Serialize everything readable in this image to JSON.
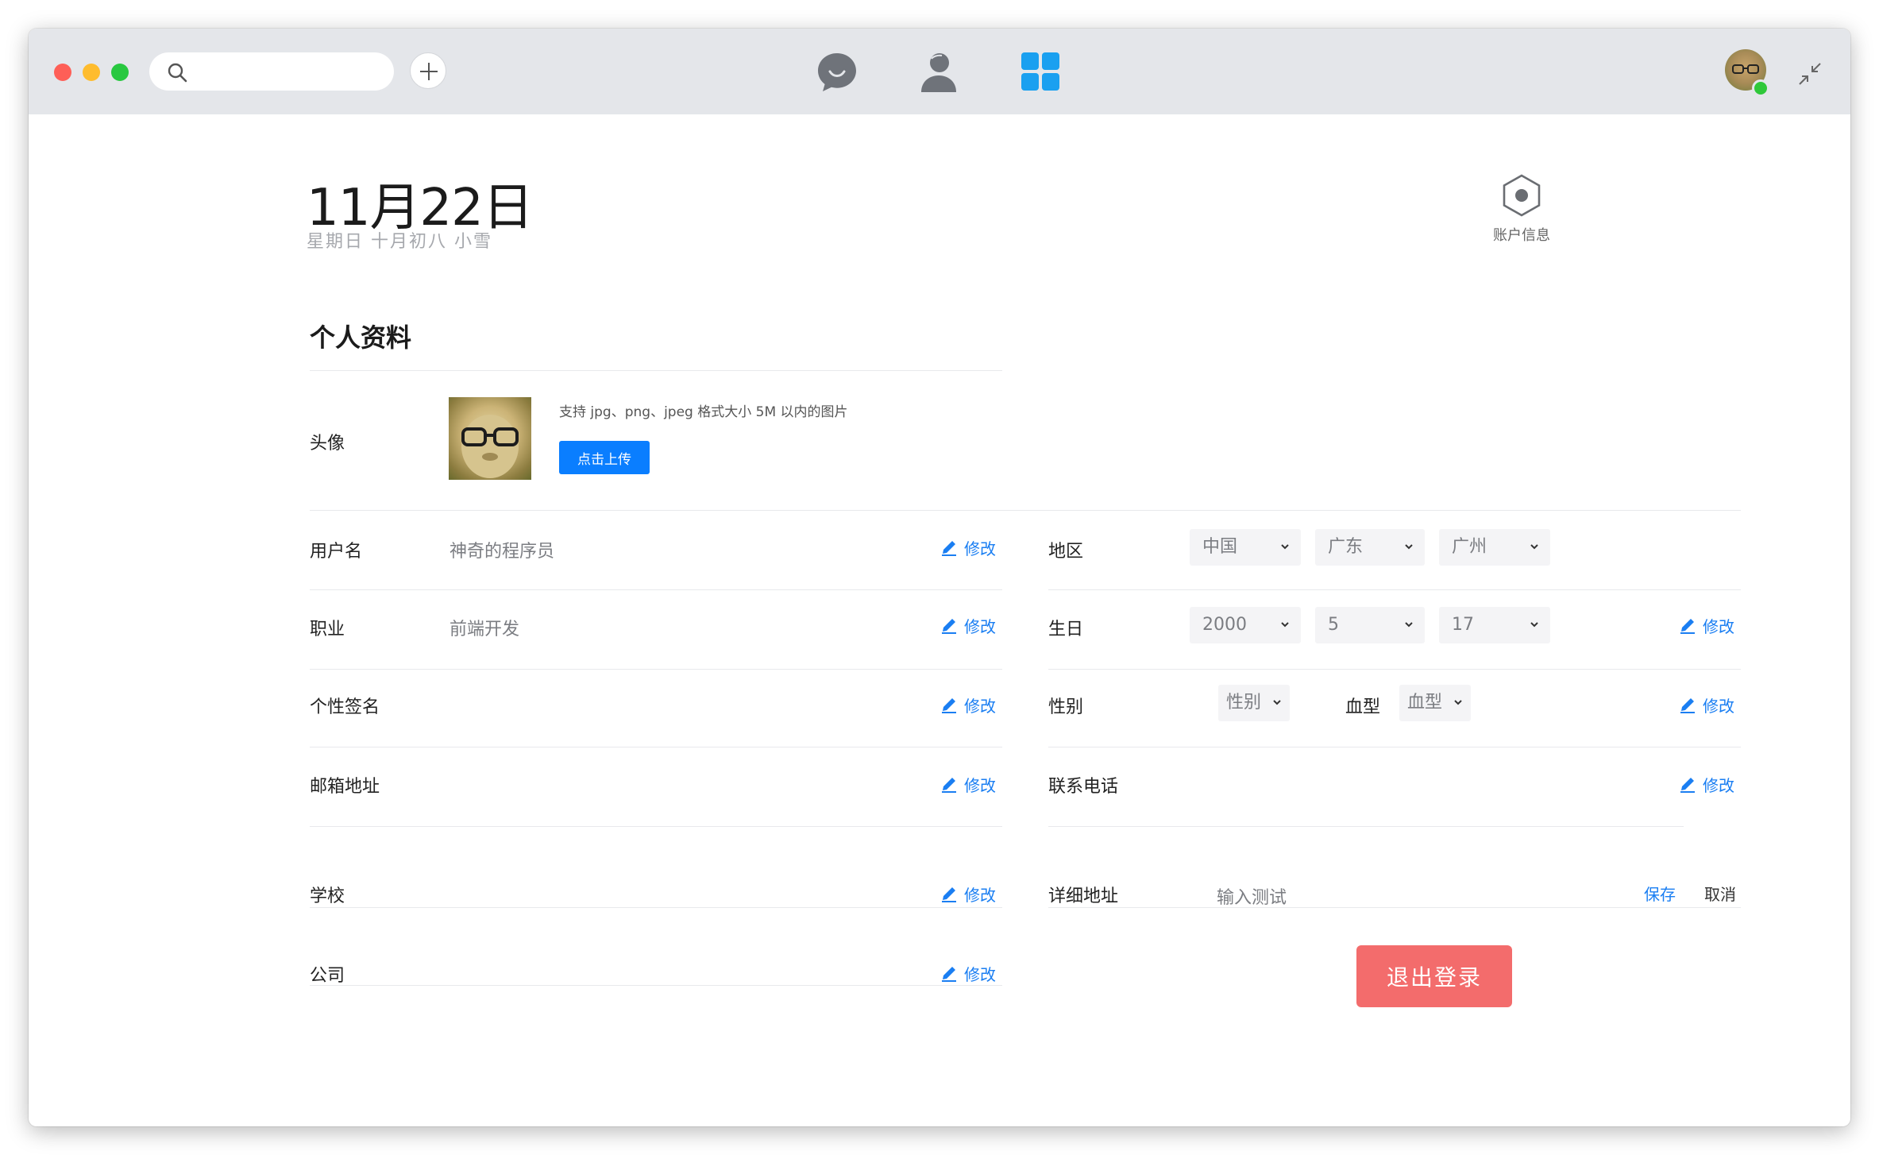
{
  "titlebar": {
    "search_placeholder": "",
    "icons": [
      "chat-icon",
      "user-icon",
      "apps-icon",
      "shrink-icon",
      "plus-icon",
      "search-icon"
    ],
    "accent_color": "#1aa0f0"
  },
  "header": {
    "date": "11月22日",
    "subtitle": "星期日  十月初八  小雪",
    "account_info_label": "账户信息"
  },
  "profile": {
    "section_title": "个人资料",
    "avatar_label": "头像",
    "avatar_hint": "支持 jpg、png、jpeg 格式大小 5M 以内的图片",
    "upload_label": "点击上传",
    "edit_label": "修改",
    "left_fields": [
      {
        "label": "用户名",
        "value": "神奇的程序员"
      },
      {
        "label": "职业",
        "value": "前端开发"
      },
      {
        "label": "个性签名",
        "value": ""
      },
      {
        "label": "邮箱地址",
        "value": ""
      },
      {
        "label": "学校",
        "value": ""
      },
      {
        "label": "公司",
        "value": ""
      }
    ],
    "right": {
      "region": {
        "label": "地区",
        "country": "中国",
        "province": "广东",
        "city": "广州"
      },
      "birthday": {
        "label": "生日",
        "year": "2000",
        "month": "5",
        "day": "17"
      },
      "gender": {
        "label": "性别",
        "select": "性别"
      },
      "blood": {
        "label": "血型",
        "select": "血型"
      },
      "phone": {
        "label": "联系电话"
      },
      "address": {
        "label": "详细地址",
        "input_value": "输入测试",
        "save_label": "保存",
        "cancel_label": "取消"
      }
    },
    "logout_label": "退出登录"
  },
  "colors": {
    "primary": "#0a7eff",
    "link": "#1a7ef2",
    "danger": "#f36c6c"
  }
}
